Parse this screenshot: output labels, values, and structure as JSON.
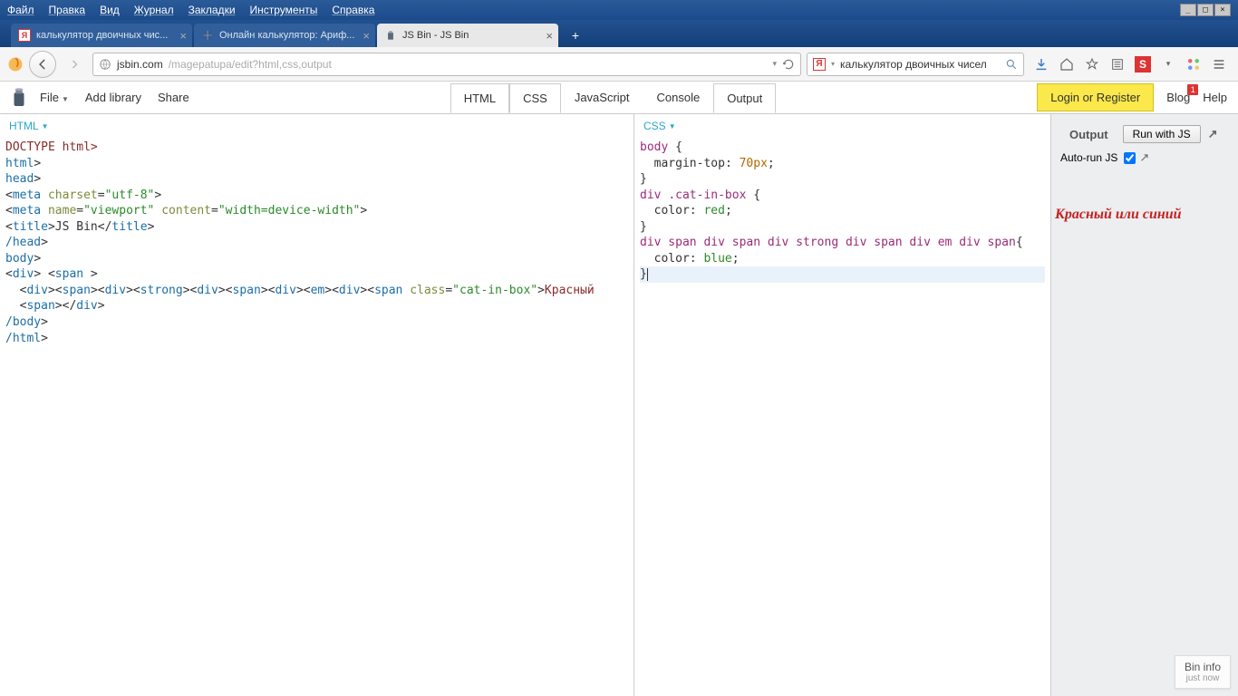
{
  "browser": {
    "menus": [
      "Файл",
      "Правка",
      "Вид",
      "Журнал",
      "Закладки",
      "Инструменты",
      "Справка"
    ],
    "tabs": [
      {
        "title": "калькулятор двоичных чис...",
        "active": false,
        "favicon": "yandex"
      },
      {
        "title": "Онлайн калькулятор: Ариф...",
        "active": false,
        "favicon": "planet"
      },
      {
        "title": "JS Bin - JS Bin",
        "active": true,
        "favicon": "jsbin"
      }
    ],
    "url_host": "jsbin.com",
    "url_path": "/magepatupa/edit?html,css,output",
    "search_value": "калькулятор двоичных чисел"
  },
  "jsbin": {
    "menu": {
      "file": "File",
      "addlib": "Add library",
      "share": "Share"
    },
    "panel_tabs": {
      "html": "HTML",
      "css": "CSS",
      "js": "JavaScript",
      "console": "Console",
      "output": "Output",
      "active": [
        "HTML",
        "CSS",
        "Output"
      ]
    },
    "login": "Login or Register",
    "blog": "Blog",
    "blog_badge": "1",
    "help": "Help"
  },
  "panels": {
    "html": {
      "label": "HTML",
      "lines": [
        [
          [
            "txt",
            "DOCTYPE html>"
          ]
        ],
        [
          [
            "tag",
            "html"
          ],
          [
            "plain",
            ">"
          ]
        ],
        [
          [
            "tag",
            "head"
          ],
          [
            "plain",
            ">"
          ]
        ],
        [
          [
            "plain",
            "<"
          ],
          [
            "tag",
            "meta"
          ],
          [
            "plain",
            " "
          ],
          [
            "attr",
            "charset"
          ],
          [
            "plain",
            "="
          ],
          [
            "str",
            "\"utf-8\""
          ],
          [
            "plain",
            ">"
          ]
        ],
        [
          [
            "plain",
            "<"
          ],
          [
            "tag",
            "meta"
          ],
          [
            "plain",
            " "
          ],
          [
            "attr",
            "name"
          ],
          [
            "plain",
            "="
          ],
          [
            "str",
            "\"viewport\""
          ],
          [
            "plain",
            " "
          ],
          [
            "attr",
            "content"
          ],
          [
            "plain",
            "="
          ],
          [
            "str",
            "\"width=device-width\""
          ],
          [
            "plain",
            ">"
          ]
        ],
        [
          [
            "plain",
            "<"
          ],
          [
            "tag",
            "title"
          ],
          [
            "plain",
            ">JS Bin</"
          ],
          [
            "tag",
            "title"
          ],
          [
            "plain",
            ">"
          ]
        ],
        [
          [
            "tag",
            "/head"
          ],
          [
            "plain",
            ">"
          ]
        ],
        [
          [
            "tag",
            "body"
          ],
          [
            "plain",
            ">"
          ]
        ],
        [
          [
            "plain",
            "<"
          ],
          [
            "tag",
            "div"
          ],
          [
            "plain",
            "> <"
          ],
          [
            "tag",
            "span"
          ],
          [
            "plain",
            " >"
          ]
        ],
        [
          [
            "plain",
            "  <"
          ],
          [
            "tag",
            "div"
          ],
          [
            "plain",
            "><"
          ],
          [
            "tag",
            "span"
          ],
          [
            "plain",
            "><"
          ],
          [
            "tag",
            "div"
          ],
          [
            "plain",
            "><"
          ],
          [
            "tag",
            "strong"
          ],
          [
            "plain",
            "><"
          ],
          [
            "tag",
            "div"
          ],
          [
            "plain",
            "><"
          ],
          [
            "tag",
            "span"
          ],
          [
            "plain",
            "><"
          ],
          [
            "tag",
            "div"
          ],
          [
            "plain",
            "><"
          ],
          [
            "tag",
            "em"
          ],
          [
            "plain",
            "><"
          ],
          [
            "tag",
            "div"
          ],
          [
            "plain",
            "><"
          ],
          [
            "tag",
            "span"
          ],
          [
            "plain",
            " "
          ],
          [
            "attr",
            "class"
          ],
          [
            "plain",
            "="
          ],
          [
            "str",
            "\"cat-in-box\""
          ],
          [
            "plain",
            ">"
          ],
          [
            "txt",
            "Красный "
          ]
        ],
        [
          [
            "plain",
            "  <"
          ],
          [
            "tag",
            "span"
          ],
          [
            "plain",
            "></"
          ],
          [
            "tag",
            "div"
          ],
          [
            "plain",
            ">"
          ]
        ],
        [
          [
            "tag",
            "/body"
          ],
          [
            "plain",
            ">"
          ]
        ],
        [
          [
            "tag",
            "/html"
          ],
          [
            "plain",
            ">"
          ]
        ]
      ]
    },
    "css": {
      "label": "CSS",
      "lines": [
        [
          [
            "sel",
            "body"
          ],
          [
            "plain",
            " {"
          ]
        ],
        [
          [
            "plain",
            "  "
          ],
          [
            "prop",
            "margin-top"
          ],
          [
            "plain",
            ": "
          ],
          [
            "num",
            "70px"
          ],
          [
            "plain",
            ";"
          ]
        ],
        [
          [
            "plain",
            "}"
          ]
        ],
        [
          [
            "sel",
            "div"
          ],
          [
            "plain",
            " "
          ],
          [
            "sel",
            ".cat-in-box"
          ],
          [
            "plain",
            " {"
          ]
        ],
        [
          [
            "plain",
            "  "
          ],
          [
            "prop",
            "color"
          ],
          [
            "plain",
            ": "
          ],
          [
            "val",
            "red"
          ],
          [
            "plain",
            ";"
          ]
        ],
        [
          [
            "plain",
            "}"
          ]
        ],
        [
          [
            "plain",
            ""
          ]
        ],
        [
          [
            "sel",
            "div span div span div strong div span div em div span"
          ],
          [
            "plain",
            "{"
          ]
        ],
        [
          [
            "plain",
            ""
          ]
        ],
        [
          [
            "plain",
            "  "
          ],
          [
            "prop",
            "color"
          ],
          [
            "plain",
            ": "
          ],
          [
            "val",
            "blue"
          ],
          [
            "plain",
            ";"
          ]
        ],
        [
          [
            "plain",
            "}"
          ],
          [
            "cursor",
            ""
          ]
        ]
      ],
      "highlight_line": 10
    },
    "output": {
      "label": "Output",
      "run_label": "Run with JS",
      "autorun_label": "Auto-run JS",
      "autorun_checked": true,
      "result_text": "Красный или синий"
    }
  },
  "bininfo": {
    "title": "Bin info",
    "sub": "just now"
  }
}
